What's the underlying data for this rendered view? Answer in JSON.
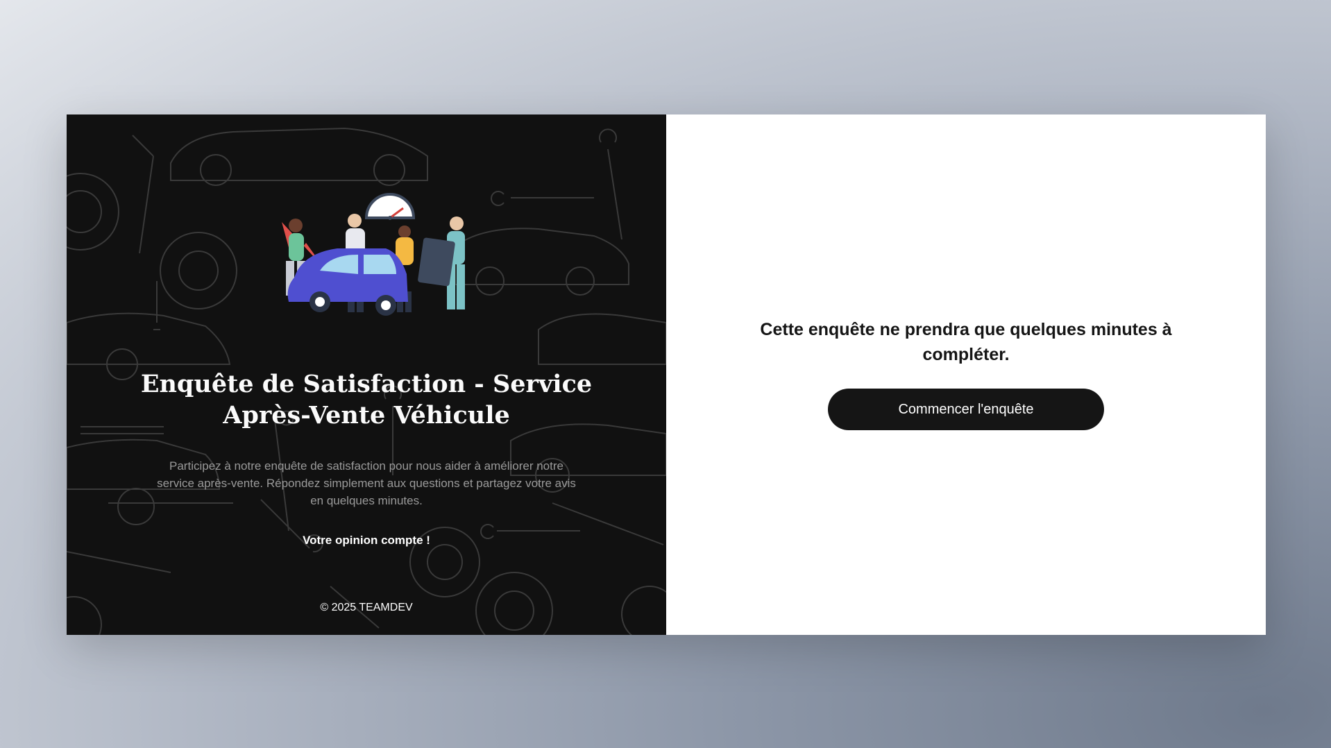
{
  "left_panel": {
    "title": "Enquête de Satisfaction - Service Après-Vente Véhicule",
    "description": "Participez à notre enquête de satisfaction pour nous aider à améliorer notre service après-vente. Répondez simplement aux questions et partagez votre avis en quelques minutes.",
    "tagline": "Votre opinion compte !",
    "footer": "© 2025 TEAMDEV",
    "illustration": "people-with-car-and-speedometer-illustration",
    "background_pattern": "car-and-tools-line-pattern"
  },
  "right_panel": {
    "intro_text": "Cette enquête ne prendra que quelques minutes à compléter.",
    "start_button_label": "Commencer l'enquête"
  },
  "colors": {
    "left_background": "#111111",
    "right_background": "#ffffff",
    "button_background": "#151515",
    "description_text": "#9a9a9a"
  }
}
